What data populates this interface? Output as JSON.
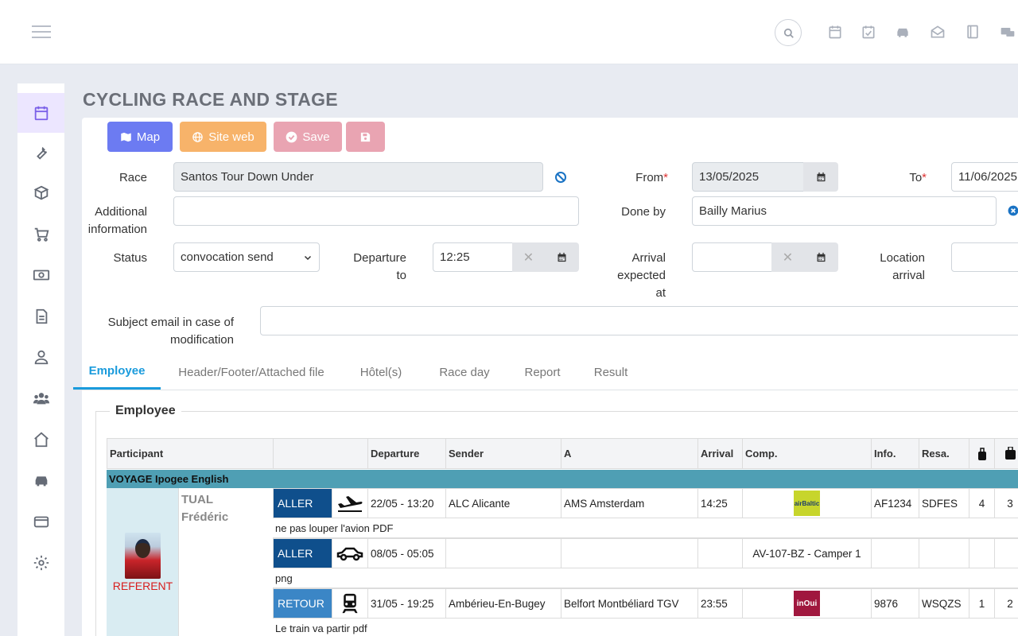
{
  "page": {
    "title": "CYCLING RACE AND STAGE"
  },
  "toolbar": {
    "map_label": "Map",
    "website_label": "Site web",
    "save_label": "Save"
  },
  "form": {
    "race_label": "Race",
    "race_value": "Santos Tour Down Under",
    "from_label": "From",
    "from_value": "13/05/2025",
    "to_label": "To",
    "to_value": "11/06/2025",
    "additional_label_1": "Additional",
    "additional_label_2": "information",
    "additional_value": "",
    "done_by_label": "Done by",
    "done_by_value": "Bailly Marius",
    "status_label": "Status",
    "status_value": "convocation send",
    "departure_label_1": "Departure",
    "departure_label_2": "to",
    "departure_value": "12:25",
    "arrival_label_1": "Arrival",
    "arrival_label_2": "expected",
    "arrival_label_3": "at",
    "arrival_value": "",
    "location_label_1": "Location",
    "location_label_2": "arrival",
    "location_value": "",
    "subject_label_1": "Subject email in case of",
    "subject_label_2": "modification",
    "subject_value": "",
    "required_mark": "*"
  },
  "tabs": [
    {
      "label": "Employee"
    },
    {
      "label": "Header/Footer/Attached file"
    },
    {
      "label": "Hôtel(s)"
    },
    {
      "label": "Race day"
    },
    {
      "label": "Report"
    },
    {
      "label": "Result"
    }
  ],
  "section": {
    "legend": "Employee"
  },
  "table": {
    "headers": [
      "Participant",
      "",
      "Departure",
      "Sender",
      "A",
      "Arrival",
      "Comp.",
      "Info.",
      "Resa."
    ],
    "group": "VOYAGE Ipogee English",
    "participant": {
      "last_name": "TUAL",
      "first_name": "Frédéric",
      "role": "REFERENT"
    },
    "rows": [
      {
        "direction": "ALLER",
        "transport": "plane",
        "departure": "22/05 - 13:20",
        "sender": "ALC Alicante",
        "to": "AMS Amsterdam",
        "arrival": "14:25",
        "company": "airBaltic",
        "info": "AF1234",
        "resa": "SDFES",
        "bag_small": "4",
        "bag_large": "3",
        "note": "ne pas louper l'avion PDF"
      },
      {
        "direction": "ALLER",
        "transport": "car",
        "departure": "08/05 - 05:05",
        "sender": "",
        "to": "",
        "arrival": "",
        "company": "AV-107-BZ - Camper 1",
        "info": "",
        "resa": "",
        "bag_small": "",
        "bag_large": "",
        "note": "png"
      },
      {
        "direction": "RETOUR",
        "transport": "train",
        "departure": "31/05 - 19:25",
        "sender": "Ambérieu-En-Bugey",
        "to": "Belfort Montbéliard TGV",
        "arrival": "23:55",
        "company": "inOui",
        "info": "9876",
        "resa": "WSQZS",
        "bag_small": "1",
        "bag_large": "2",
        "note": "Le train va partir pdf"
      }
    ]
  },
  "colors": {
    "accent": "#1a9bdc",
    "map_button": "#6c7bf2",
    "web_button": "#f7b36a",
    "save_button": "#e9a4b2",
    "aller": "#0f4f8c",
    "retour": "#3b86c6",
    "group_row": "#4f9fb4",
    "referent": "#d81d1d"
  }
}
